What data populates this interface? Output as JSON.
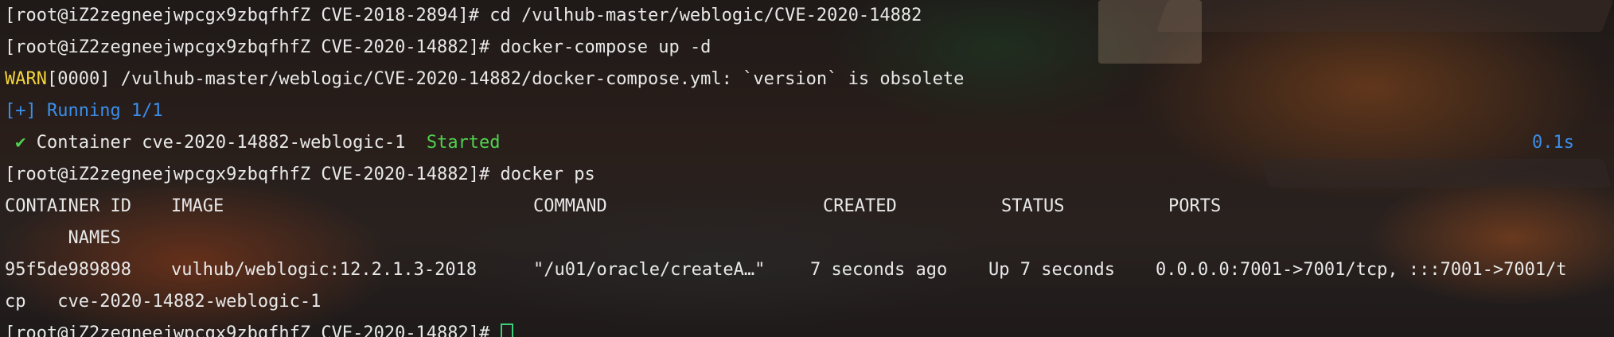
{
  "terminal": {
    "lines": [
      {
        "prompt": "[root@iZ2zegneejwpcgx9zbqfhfZ CVE-2018-2894]#",
        "cmd": " cd /vulhub-master/weblogic/CVE-2020-14882"
      },
      {
        "prompt": "[root@iZ2zegneejwpcgx9zbqfhfZ CVE-2020-14882]#",
        "cmd": " docker-compose up -d"
      },
      {
        "warn_tag": "WARN",
        "text": "[0000] /vulhub-master/weblogic/CVE-2020-14882/docker-compose.yml: `version` is obsolete"
      },
      {
        "text": "[+] Running 1/1"
      },
      {
        "check": "✔",
        "text": " Container cve-2020-14882-weblogic-1  ",
        "status": "Started",
        "time": "0.1s"
      },
      {
        "prompt": "[root@iZ2zegneejwpcgx9zbqfhfZ CVE-2020-14882]#",
        "cmd": " docker ps"
      }
    ],
    "table": {
      "headers": {
        "container_id": "CONTAINER ID",
        "image": "IMAGE",
        "command": "COMMAND",
        "created": "CREATED",
        "status": "STATUS",
        "ports": "PORTS",
        "names": "NAMES"
      },
      "row": {
        "container_id": "95f5de989898",
        "image": "vulhub/weblogic:12.2.1.3-2018",
        "command": "\"/u01/oracle/createA…\"",
        "created": "7 seconds ago",
        "status": "Up 7 seconds",
        "ports_part1": "0.0.0.0:7001->7001/tcp, :::7001->7001/t",
        "ports_part2": "cp",
        "names": "cve-2020-14882-weblogic-1"
      }
    },
    "last_prompt": "[root@iZ2zegneejwpcgx9zbqfhfZ CVE-2020-14882]#"
  },
  "colors": {
    "warn": "#f2d33a",
    "info": "#3b8eea",
    "success": "#4fd24f",
    "cursor": "#3ccf7a"
  }
}
